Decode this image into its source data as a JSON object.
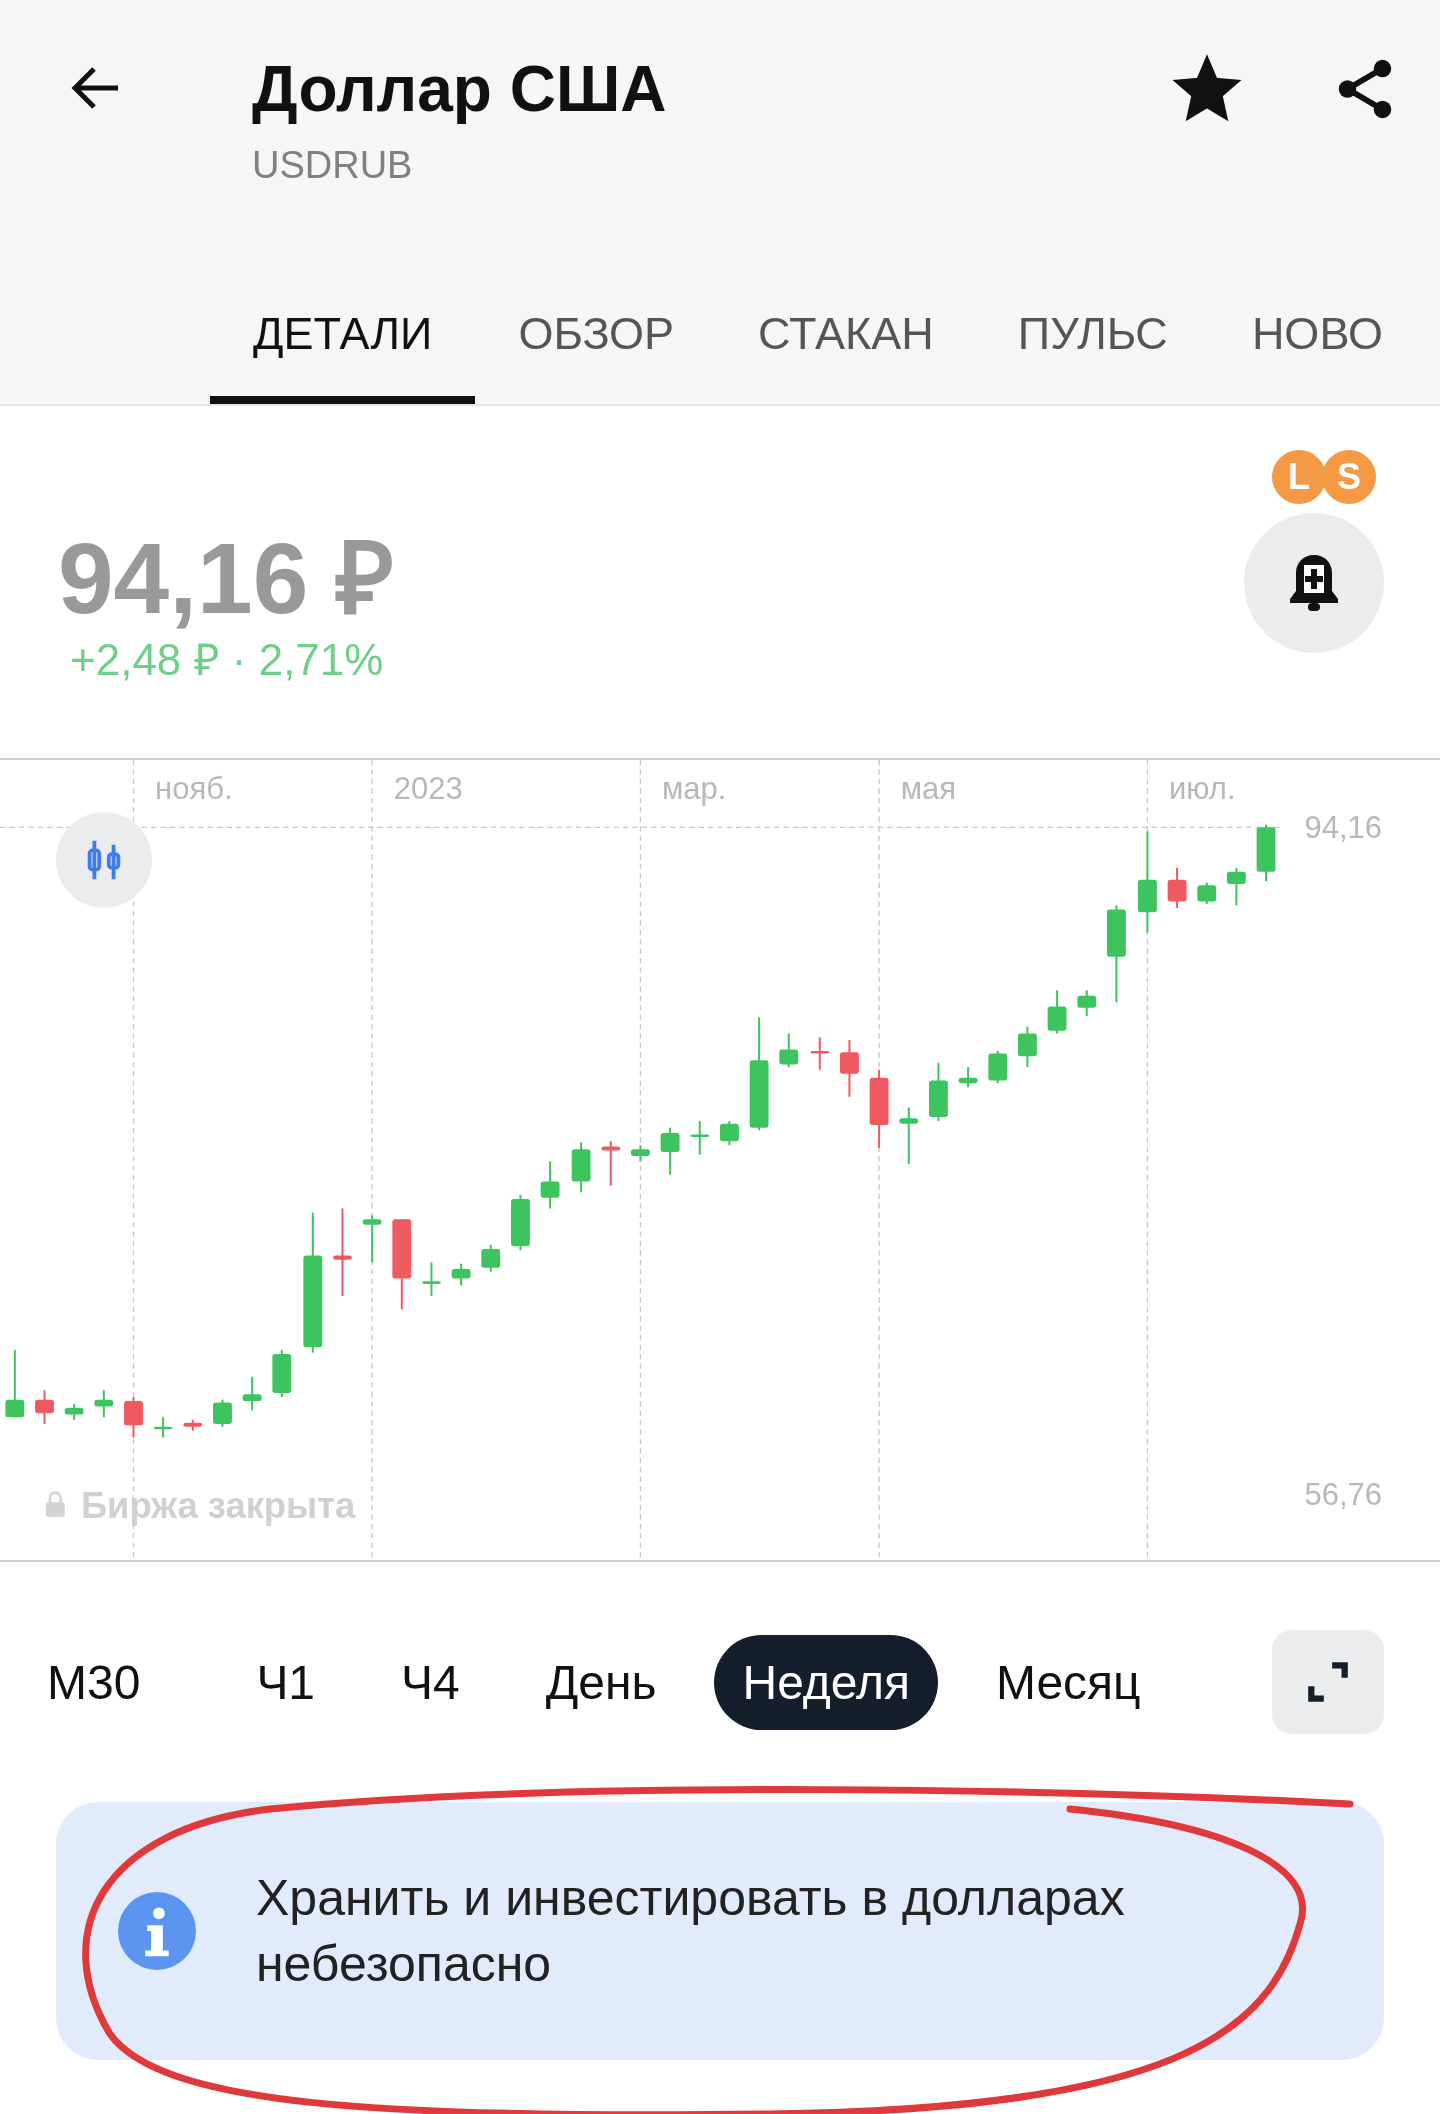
{
  "header": {
    "title": "Доллар США",
    "ticker": "USDRUB",
    "favorite": true
  },
  "tabs": [
    {
      "label": "ДЕТАЛИ",
      "selected": true
    },
    {
      "label": "ОБЗОР",
      "selected": false
    },
    {
      "label": "СТАКАН",
      "selected": false
    },
    {
      "label": "ПУЛЬС",
      "selected": false
    },
    {
      "label": "НОВО",
      "selected": false
    }
  ],
  "price": {
    "value": "94,16 ₽",
    "change": "+2,48 ₽ · 2,71%"
  },
  "badges": [
    "L",
    "S"
  ],
  "chart": {
    "x_labels": [
      "нояб.",
      "2023",
      "мар.",
      "мая",
      "июл."
    ],
    "price_high": "94,16",
    "price_low": "56,76",
    "status": "Биржа закрыта"
  },
  "timeframes": [
    {
      "label": "М30",
      "selected": false
    },
    {
      "label": "Ч1",
      "selected": false
    },
    {
      "label": "Ч4",
      "selected": false
    },
    {
      "label": "День",
      "selected": false
    },
    {
      "label": "Неделя",
      "selected": true
    },
    {
      "label": "Месяц",
      "selected": false
    }
  ],
  "notice": {
    "text": "Хранить и инвестировать в долларах небезопасно"
  }
}
